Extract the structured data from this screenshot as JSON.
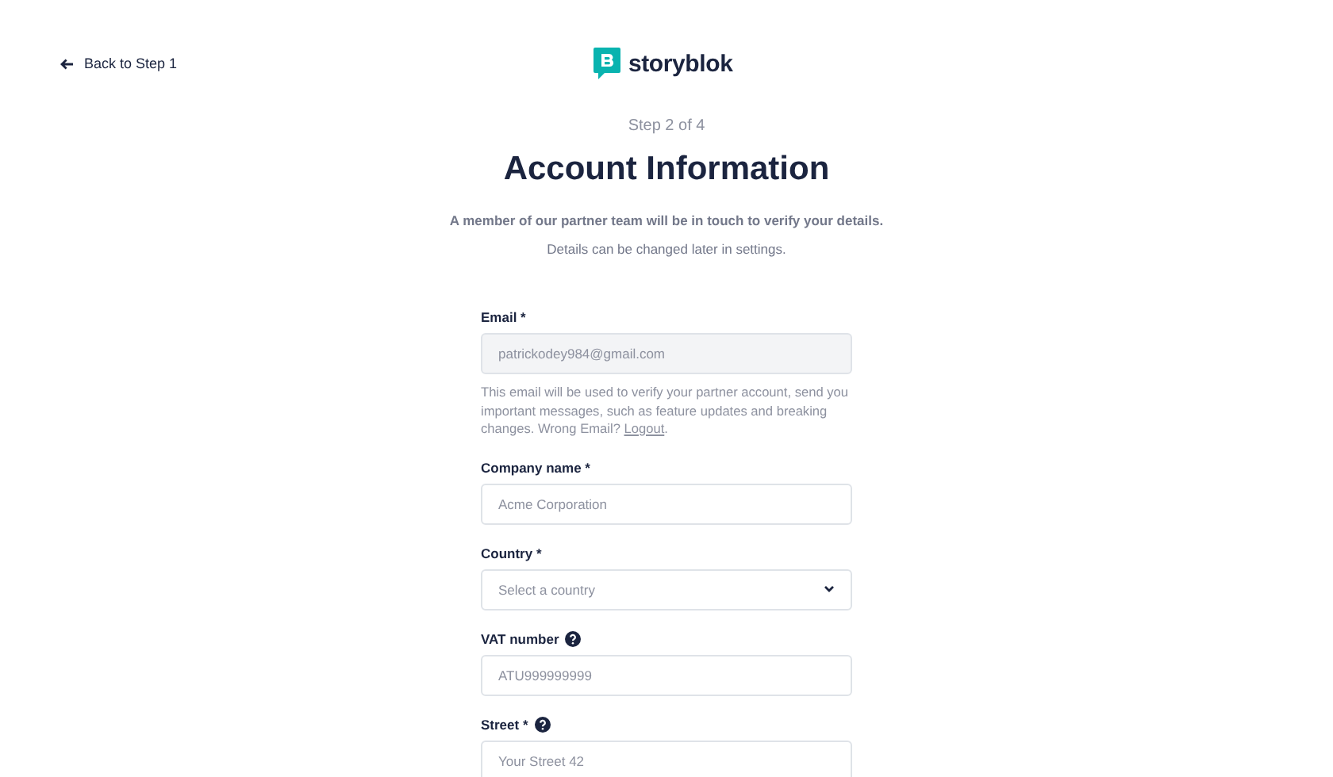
{
  "back_link": {
    "label": "Back to Step 1"
  },
  "logo": {
    "text": "storyblok"
  },
  "step": "Step 2 of 4",
  "title": "Account Information",
  "intro": [
    "A member of our partner team will be in touch to verify your details.",
    "Details can be changed later in settings."
  ],
  "fields": [
    {
      "kind": "input",
      "label": "Email *",
      "help": false,
      "value": "patrickodey984@gmail.com",
      "disabled": true,
      "note": "This email will be used to verify your partner account, send you important messages, such as feature updates and breaking changes. Wrong Email?",
      "note_link": "Logout",
      "note_end": "."
    },
    {
      "kind": "input",
      "label": "Company name *",
      "help": false,
      "placeholder": "Acme Corporation"
    },
    {
      "kind": "select",
      "label": "Country *",
      "help": false,
      "placeholder": "Select a country"
    },
    {
      "kind": "input",
      "label": "VAT number",
      "help": true,
      "placeholder": "ATU999999999"
    },
    {
      "kind": "input",
      "label": "Street *",
      "help": true,
      "placeholder": "Your Street 42"
    }
  ]
}
